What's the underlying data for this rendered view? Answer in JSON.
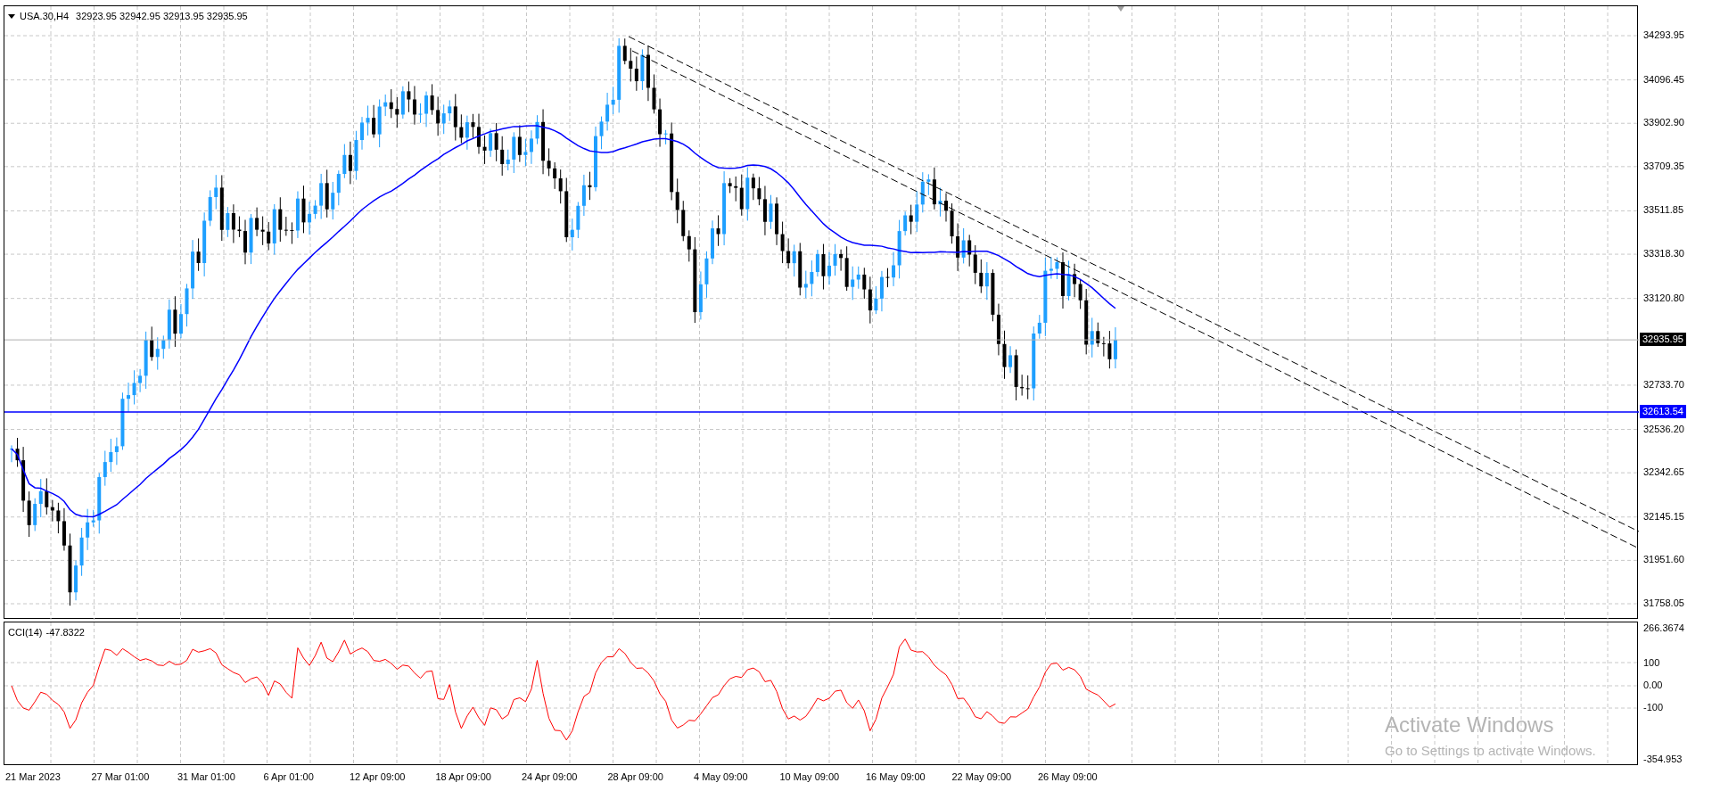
{
  "chart_header": {
    "symbol": "USA.30,H4",
    "ohlc": "32923.95 32942.95 32913.95 32935.95"
  },
  "price_axis": {
    "labels": [
      "34293.95",
      "34096.45",
      "33902.90",
      "33709.35",
      "33511.85",
      "33318.30",
      "33120.80",
      "32733.70",
      "32536.20",
      "32342.65",
      "32145.15",
      "31951.60",
      "31758.05"
    ]
  },
  "price_markers": [
    {
      "kind": "bid",
      "label": "32935.95",
      "color": "#000000"
    },
    {
      "kind": "hline",
      "label": "32613.54",
      "color": "#0000ff"
    }
  ],
  "indicator": {
    "title": "CCI(14)",
    "value": "-47.8322",
    "axis_labels": [
      "266.3674",
      "100",
      "0.00",
      "-100",
      "-354.953"
    ]
  },
  "time_axis": {
    "labels": [
      "21 Mar 2023",
      "27 Mar 01:00",
      "31 Mar 01:00",
      "6 Apr 01:00",
      "12 Apr 09:00",
      "18 Apr 09:00",
      "24 Apr 09:00",
      "28 Apr 09:00",
      "4 May 09:00",
      "10 May 09:00",
      "16 May 09:00",
      "22 May 09:00",
      "26 May 09:00"
    ]
  },
  "os_watermark": {
    "title": "Activate Windows",
    "subtitle": "Go to Settings to activate Windows."
  }
}
